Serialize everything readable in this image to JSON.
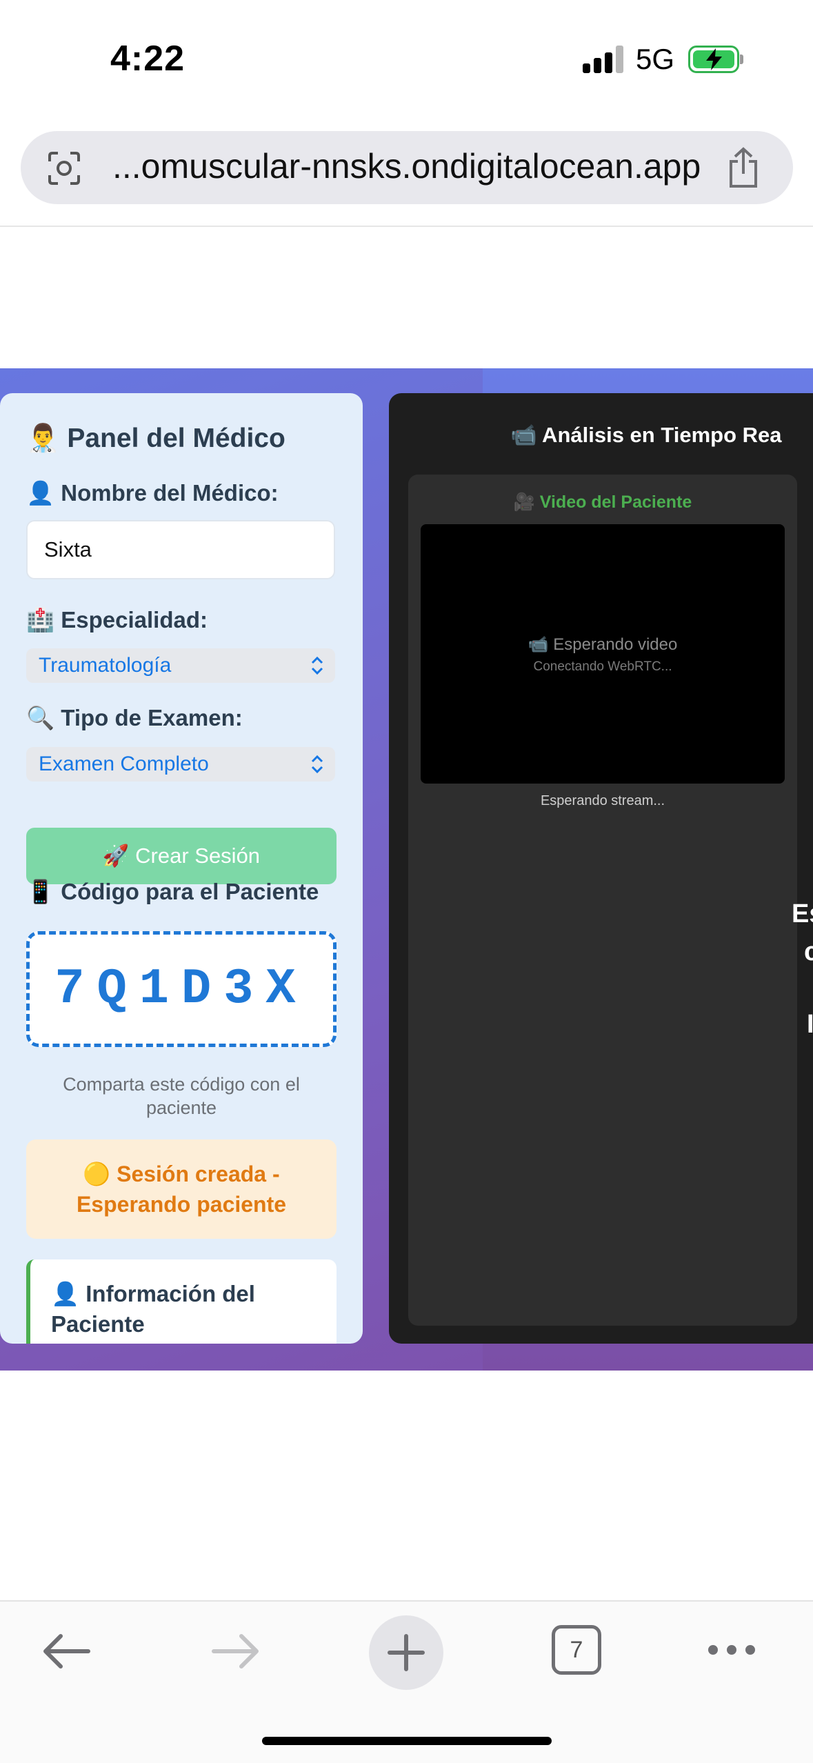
{
  "status_bar": {
    "time": "4:22",
    "network": "5G"
  },
  "browser": {
    "url": "...omuscular-nnsks.ondigitalocean.app",
    "tabs_count": "7"
  },
  "doctor_panel": {
    "title": "👨‍⚕️ Panel del Médico",
    "name_label": "👤 Nombre del Médico:",
    "name_value": "Sixta",
    "specialty_label": "🏥 Especialidad:",
    "specialty_value": "Traumatología",
    "exam_label": "🔍 Tipo de Examen:",
    "exam_value": "Examen Completo",
    "create_button": "🚀 Crear Sesión",
    "code_label": "📱 Código para el Paciente",
    "code": "7Q1D3X",
    "code_hint": "Comparta este código con el paciente",
    "status_line1": "🟡 Sesión creada -",
    "status_line2": "Esperando paciente",
    "patient_info_title": "👤 Información del Paciente"
  },
  "analysis_panel": {
    "title": "📹 Análisis en Tiempo Rea",
    "video_label": "🎥 Video del Paciente",
    "video_waiting": "📹 Esperando video",
    "video_sub": "Conectando WebRTC...",
    "stream_status": "Esperando stream...",
    "fragments": [
      "Es",
      "c",
      "I"
    ]
  },
  "colors": {
    "accent_blue": "#1f78d6",
    "success_green": "#4caf50",
    "warning_orange": "#e07a12",
    "button_green": "#7dd8a7"
  },
  "icons": {
    "address_left": "camera-lens-icon",
    "address_right": "share-icon",
    "back": "back-arrow-icon",
    "forward": "forward-arrow-icon",
    "new_tab": "plus-icon",
    "tabs": "tabs-icon",
    "more": "more-dots-icon"
  }
}
